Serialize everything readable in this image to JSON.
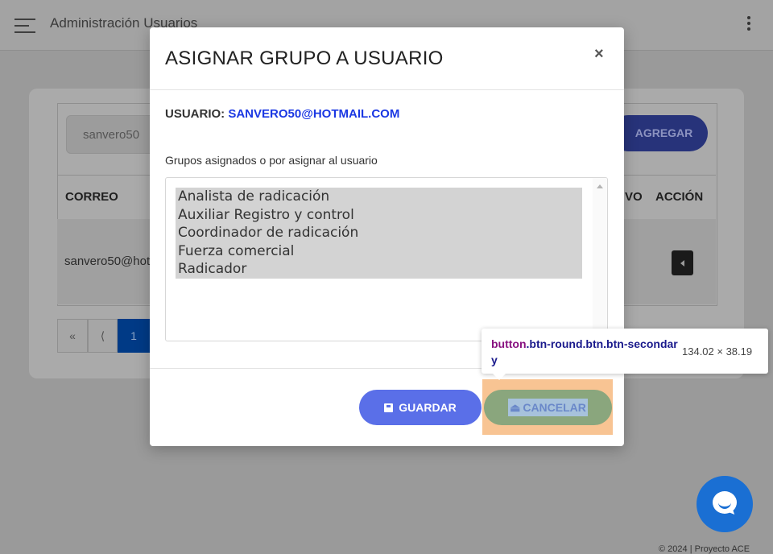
{
  "topbar": {
    "title": "Administración Usuarios",
    "menu_icon": "hamburger-icon",
    "more_icon": "kebab-icon"
  },
  "background": {
    "search_value": "sanvero50",
    "add_button": "AGREGAR",
    "table": {
      "headers": [
        "CORREO",
        "VO",
        "ACCIÓN"
      ],
      "rows": [
        {
          "correo": "sanvero50@hotmail.com"
        }
      ]
    },
    "pagination": {
      "first": "«",
      "prev": "⟨",
      "current": "1"
    }
  },
  "modal": {
    "title": "ASIGNAR GRUPO A USUARIO",
    "close": "×",
    "user_label": "USUARIO:",
    "user_value": "SANVERO50@HOTMAIL.COM",
    "groups_label": "Grupos asignados o por asignar al usuario",
    "groups": [
      "Analista de radicación",
      "Auxiliar Registro y control",
      "Coordinador de radicación",
      "Fuerza comercial",
      "Radicador"
    ],
    "save_button": "GUARDAR",
    "cancel_button": "CANCELAR"
  },
  "devtools_tooltip": {
    "tag": "button",
    "classes": ".btn-round.btn.btn-secondary",
    "size": "134.02 × 38.19"
  },
  "footer": {
    "text": "© 2024 | Proyecto ACE"
  },
  "colors": {
    "primary": "#5a6fe8",
    "secondary": "#8aa67d",
    "user_email": "#1b38e3",
    "page_active": "#003a86"
  }
}
